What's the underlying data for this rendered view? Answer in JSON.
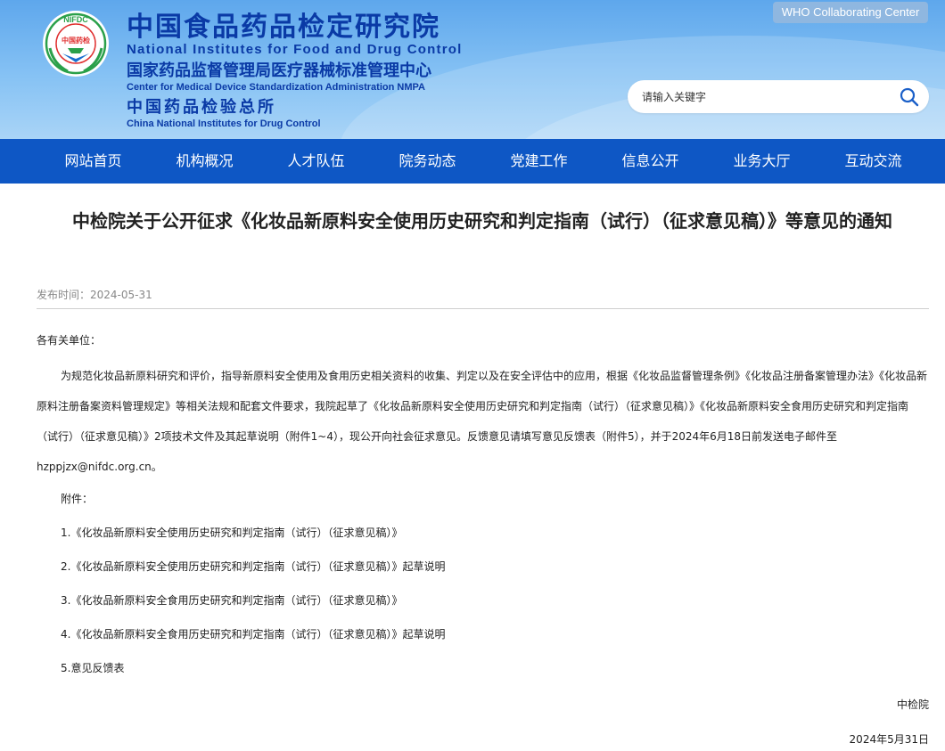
{
  "header": {
    "logo_text_top": "NIFDC",
    "logo_text_center": "中国药检",
    "title_cn": "中国食品药品检定研究院",
    "title_en": "National Institutes for Food and Drug Control",
    "subtitle_cn": "国家药品监督管理局医疗器械标准管理中心",
    "subtitle_en": "Center for Medical Device Standardization Administration NMPA",
    "sub2_cn": "中国药品检验总所",
    "sub2_en": "China National Institutes for Drug Control",
    "who_badge": "WHO Collaborating Center",
    "brand_color": "#0a3aa6"
  },
  "search": {
    "placeholder": "请输入关键字",
    "icon": "search-icon"
  },
  "nav": {
    "color": "#0e57c5",
    "items": [
      {
        "label": "网站首页"
      },
      {
        "label": "机构概况"
      },
      {
        "label": "人才队伍"
      },
      {
        "label": "院务动态"
      },
      {
        "label": "党建工作"
      },
      {
        "label": "信息公开"
      },
      {
        "label": "业务大厅"
      },
      {
        "label": "互动交流"
      }
    ]
  },
  "article": {
    "title": "中检院关于公开征求《化妆品新原料安全使用历史研究和判定指南（试行）（征求意见稿）》等意见的通知",
    "publish_label": "发布时间：2024-05-31",
    "salutation": "各有关单位：",
    "paragraph": "为规范化妆品新原料研究和评价，指导新原料安全使用及食用历史相关资料的收集、判定以及在安全评估中的应用，根据《化妆品监督管理条例》《化妆品注册备案管理办法》《化妆品新原料注册备案资料管理规定》等相关法规和配套文件要求，我院起草了《化妆品新原料安全使用历史研究和判定指南（试行）（征求意见稿）》《化妆品新原料安全食用历史研究和判定指南（试行）（征求意见稿）》2项技术文件及其起草说明（附件1~4），现公开向社会征求意见。反馈意见请填写意见反馈表（附件5），并于2024年6月18日前发送电子邮件至hzppjzx@nifdc.org.cn。",
    "attachments_label": "附件：",
    "attachments": [
      "1.《化妆品新原料安全使用历史研究和判定指南（试行）（征求意见稿）》",
      "2.《化妆品新原料安全使用历史研究和判定指南（试行）（征求意见稿）》起草说明",
      "3.《化妆品新原料安全食用历史研究和判定指南（试行）（征求意见稿）》",
      "4.《化妆品新原料安全食用历史研究和判定指南（试行）（征求意见稿）》起草说明",
      "5.意见反馈表"
    ],
    "signature": "中检院",
    "sign_date": "2024年5月31日"
  }
}
